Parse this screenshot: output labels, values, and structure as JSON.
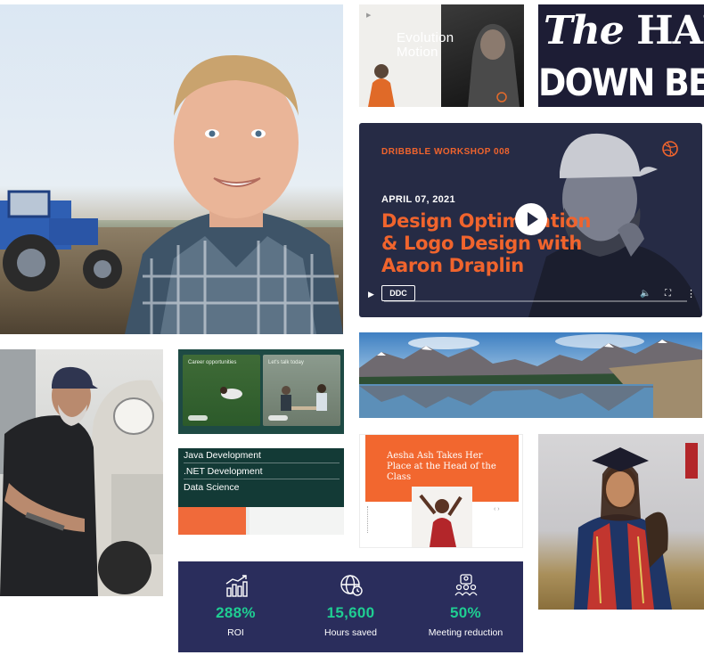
{
  "evolution": {
    "title_line1": "Evolution",
    "title_line2": "Motion"
  },
  "hands": {
    "word1": "The",
    "word2": "HANDS",
    "line2": "DOWN BEST"
  },
  "dribbble": {
    "kicker": "DRIBBBLE WORKSHOP 008",
    "date": "APRIL 07, 2021",
    "headline": "Design Optimization & Logo Design with Aaron Draplin",
    "logo_text": "DDC"
  },
  "career": {
    "card1_caption": "Career opportunities",
    "card2_caption": "Let's talk today"
  },
  "courses": {
    "items": [
      "Java Development",
      ".NET Development",
      "Data Science"
    ]
  },
  "aesha": {
    "headline": "Aesha Ash Takes Her Place at the Head of the Class"
  },
  "stats": {
    "accent_color": "#1fce92",
    "background_color": "#2a2d5c",
    "items": [
      {
        "icon": "bar-chart-icon",
        "value": "288%",
        "label": "ROI"
      },
      {
        "icon": "globe-clock-icon",
        "value": "15,600",
        "label": "Hours saved"
      },
      {
        "icon": "meeting-people-icon",
        "value": "50%",
        "label": "Meeting reduction"
      }
    ]
  },
  "colors": {
    "orange": "#f0642d",
    "navy": "#262b45",
    "teal": "#133a36"
  }
}
